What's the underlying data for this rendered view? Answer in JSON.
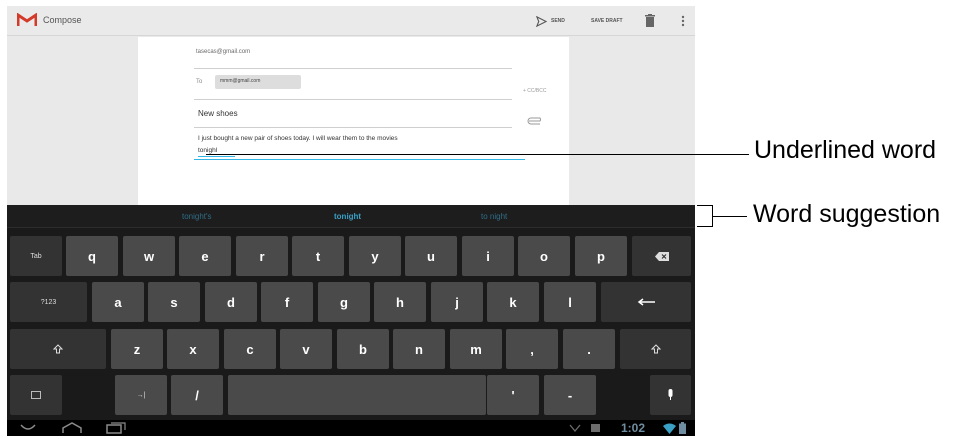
{
  "action_bar": {
    "title": "Compose",
    "send_label": "SEND",
    "save_draft_label": "SAVE DRAFT"
  },
  "compose": {
    "from": "tasecas@gmail.com",
    "to_chip": "mmm@gmail.com",
    "cc_bcc": "+ CC/BCC",
    "subject": "New shoes",
    "body_line1": "I just bought a new pair of shoes today. I will wear them to the movies",
    "body_line2": "tonighl"
  },
  "suggestions": {
    "left": "tonight's",
    "center": "tonight",
    "right": "to night"
  },
  "keyboard": {
    "tab": "Tab",
    "row1": [
      "q",
      "w",
      "e",
      "r",
      "t",
      "y",
      "u",
      "i",
      "o",
      "p"
    ],
    "symbols": "?123",
    "row2": [
      "a",
      "s",
      "d",
      "f",
      "g",
      "h",
      "j",
      "k",
      "l"
    ],
    "row3": [
      "z",
      "x",
      "c",
      "v",
      "b",
      "n",
      "m",
      ",",
      "."
    ],
    "slash": "/",
    "tab_arrow": "→|"
  },
  "status": {
    "time": "1:02"
  },
  "annotations": {
    "underlined_word": "Underlined word",
    "word_suggestion": "Word suggestion"
  },
  "icons": {
    "logo": "gmail-logo-icon",
    "send": "send-icon",
    "trash": "trash-icon",
    "overflow": "overflow-menu-icon",
    "attach": "attachment-icon",
    "backspace": "backspace-icon",
    "enter": "enter-icon",
    "shift": "shift-icon",
    "settings": "keyboard-settings-icon",
    "microphone": "microphone-icon",
    "back": "back-icon",
    "home": "home-icon",
    "recent": "recent-apps-icon",
    "wifi": "wifi-icon",
    "battery": "battery-icon"
  },
  "colors": {
    "accent": "#33b5e5",
    "suggestion": "#3aa0c6",
    "keyboard_bg": "#1a1a1a",
    "key": "#4a4a4a"
  }
}
